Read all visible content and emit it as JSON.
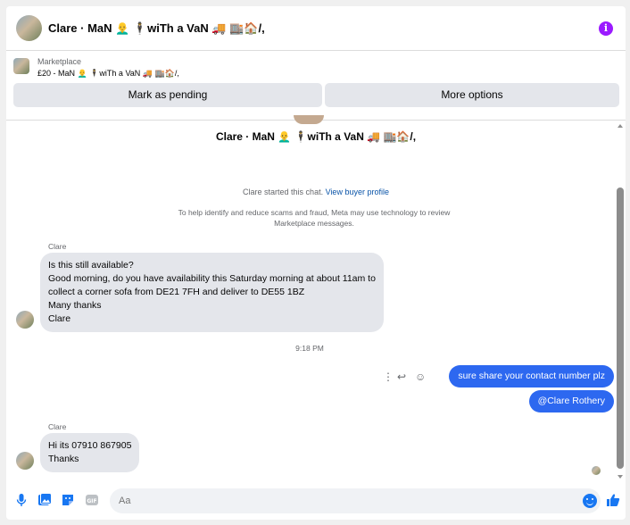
{
  "header": {
    "title": "Clare · MaN 👨‍🦲 🕴️wiTh a VaN 🚚 🏬🏠/,",
    "info_icon": "info-icon"
  },
  "listing": {
    "marketplace_label": "Marketplace",
    "item_title": "£20 - MaN 👨‍🦲 🕴️wiTh a VaN 🚚 🏬🏠/,",
    "mark_pending_label": "Mark as pending",
    "more_options_label": "More options"
  },
  "thread": {
    "name": "Clare · MaN 👨‍🦲 🕴️wiTh a VaN 🚚 🏬🏠/,",
    "started_text": "Clare started this chat.",
    "view_buyer_profile": "View buyer profile",
    "notice": "To help identify and reduce scams and fraud, Meta may use technology to review Marketplace messages.",
    "messages": [
      {
        "sender": "Clare",
        "lines": [
          "Is this still available?",
          "Good morning,  do you have availability this Saturday morning at about 11am to",
          "collect a corner sofa from DE21 7FH and deliver to DE55 1BZ",
          "Many thanks",
          "Clare"
        ]
      },
      {
        "timestamp": "9:18 PM"
      },
      {
        "outgoing_1": "sure share your contact number plz",
        "outgoing_2": "@Clare Rothery"
      },
      {
        "sender": "Clare",
        "lines": [
          "Hi its 07910 867905",
          "Thanks"
        ]
      }
    ]
  },
  "composer": {
    "placeholder": "Aa",
    "icons": [
      "microphone-icon",
      "photo-icon",
      "sticker-icon",
      "gif-icon",
      "emoji-icon",
      "thumbs-up-icon"
    ]
  },
  "colors": {
    "accent": "#2d68f0",
    "info": "#9b1aff",
    "bubble_in": "#e4e6eb",
    "link": "#0a54a8"
  }
}
